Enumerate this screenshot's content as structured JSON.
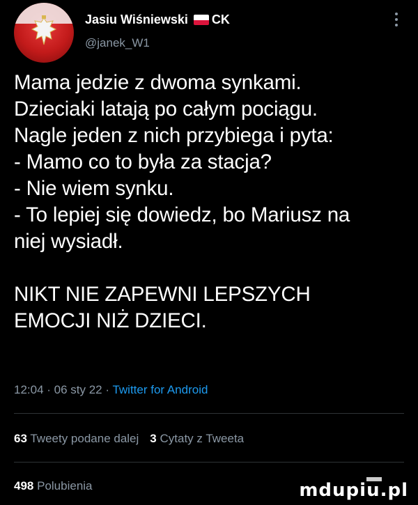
{
  "author": {
    "name": "Jasiu Wiśniewski",
    "suffix": "CK",
    "handle": "@janek_W1"
  },
  "tweet": {
    "lines": [
      "Mama jedzie z dwoma synkami.",
      "Dzieciaki latają po całym pociągu.",
      "Nagle jeden z nich przybiega i pyta:",
      "- Mamo co to była za stacja?",
      "- Nie wiem synku.",
      "- To lepiej się dowiedz, bo Mariusz na",
      "niej wysiadł."
    ],
    "punchline_1": "NIKT NIE ZAPEWNI LEPSZYCH",
    "punchline_2": "EMOCJI NIŻ DZIECI."
  },
  "meta": {
    "time_date": "12:04 · 06 sty 22 · ",
    "source": "Twitter for Android"
  },
  "stats": {
    "retweets_count": "63",
    "retweets_label": "Tweety podane dalej",
    "quotes_count": "3",
    "quotes_label": "Cytaty z Tweeta",
    "likes_count": "498",
    "likes_label": "Polubienia"
  },
  "watermark": "mdupiu.pl",
  "colors": {
    "background": "#000000",
    "text": "#ffffff",
    "muted": "#8b98a5",
    "link": "#1d9bf0",
    "divider": "#2f3336"
  }
}
